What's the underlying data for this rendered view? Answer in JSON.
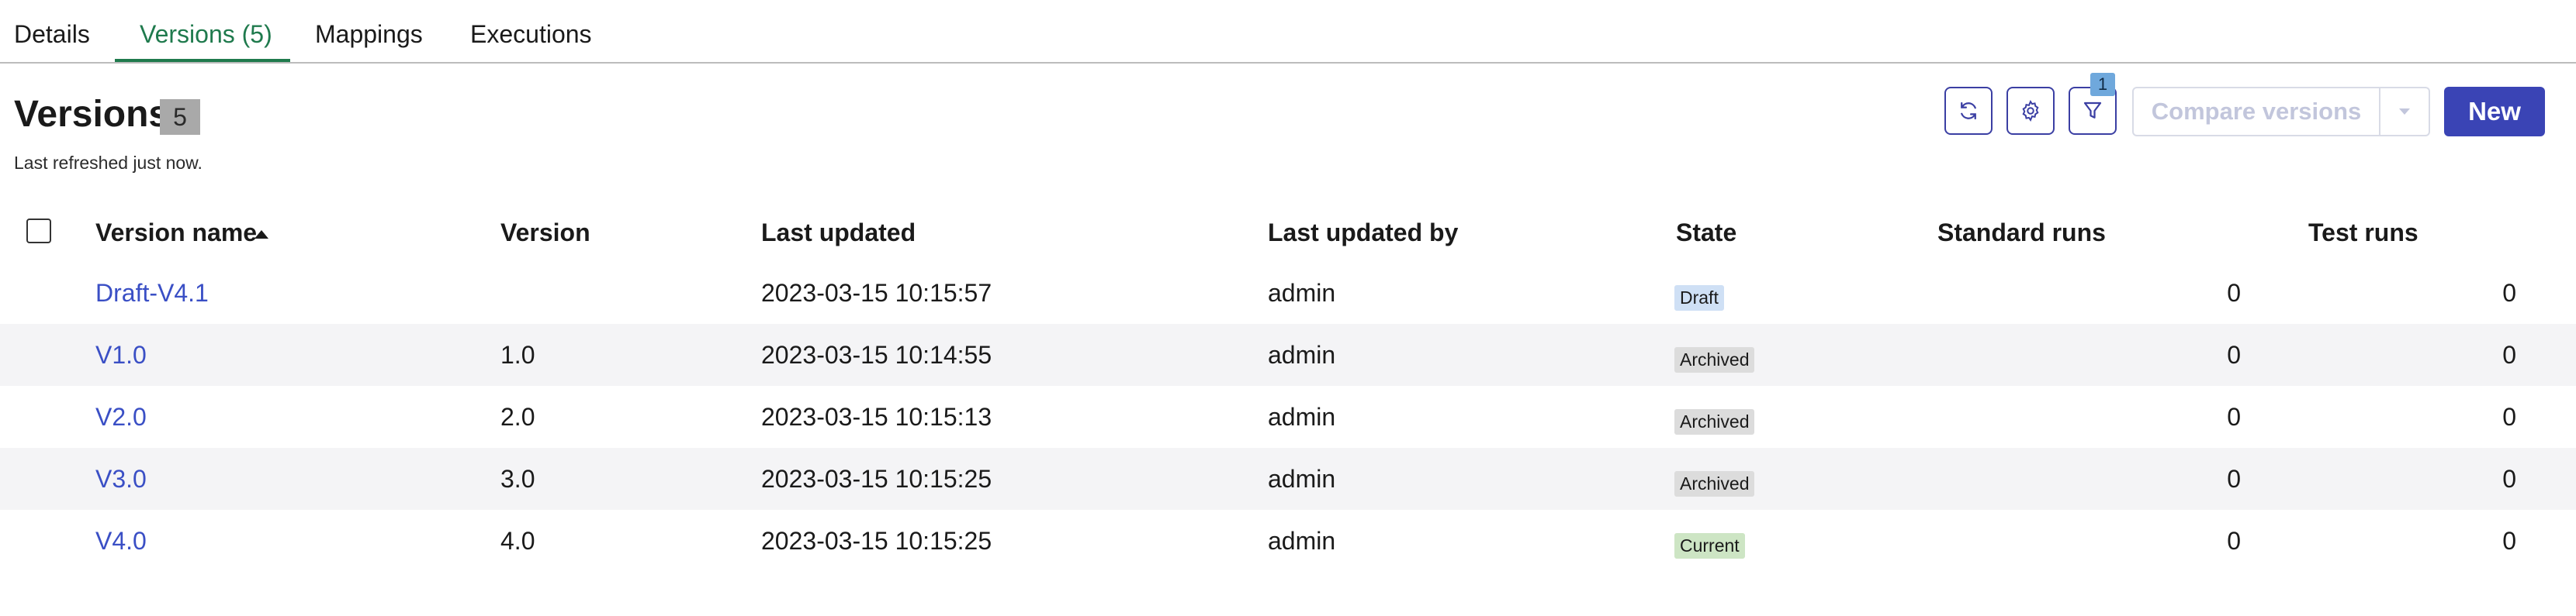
{
  "tabs": [
    {
      "label": "Details"
    },
    {
      "label": "Versions (5)"
    },
    {
      "label": "Mappings"
    },
    {
      "label": "Executions"
    }
  ],
  "page": {
    "title": "Versions",
    "count": "5",
    "refreshed": "Last refreshed just now."
  },
  "toolbar": {
    "refresh_icon": "refresh-icon",
    "settings_icon": "gear-icon",
    "filter_icon": "filter-icon",
    "filter_badge": "1",
    "compare_label": "Compare versions",
    "new_label": "New"
  },
  "table": {
    "headers": {
      "name": "Version name",
      "version": "Version",
      "updated": "Last updated",
      "updated_by": "Last updated by",
      "state": "State",
      "standard_runs": "Standard runs",
      "test_runs": "Test runs"
    },
    "rows": [
      {
        "name": "Draft-V4.1",
        "version": "",
        "updated": "2023-03-15 10:15:57",
        "updated_by": "admin",
        "state": "Draft",
        "standard_runs": "0",
        "test_runs": "0"
      },
      {
        "name": "V1.0",
        "version": "1.0",
        "updated": "2023-03-15 10:14:55",
        "updated_by": "admin",
        "state": "Archived",
        "standard_runs": "0",
        "test_runs": "0"
      },
      {
        "name": "V2.0",
        "version": "2.0",
        "updated": "2023-03-15 10:15:13",
        "updated_by": "admin",
        "state": "Archived",
        "standard_runs": "0",
        "test_runs": "0"
      },
      {
        "name": "V3.0",
        "version": "3.0",
        "updated": "2023-03-15 10:15:25",
        "updated_by": "admin",
        "state": "Archived",
        "standard_runs": "0",
        "test_runs": "0"
      },
      {
        "name": "V4.0",
        "version": "4.0",
        "updated": "2023-03-15 10:15:25",
        "updated_by": "admin",
        "state": "Current",
        "standard_runs": "0",
        "test_runs": "0"
      }
    ]
  },
  "colors": {
    "accent_tab": "#1f7a4d",
    "primary_button": "#3a44b5",
    "link": "#3a4fc5",
    "state_draft": "#cfe0f5",
    "state_archived": "#dcdcdc",
    "state_current": "#cde5c4"
  }
}
